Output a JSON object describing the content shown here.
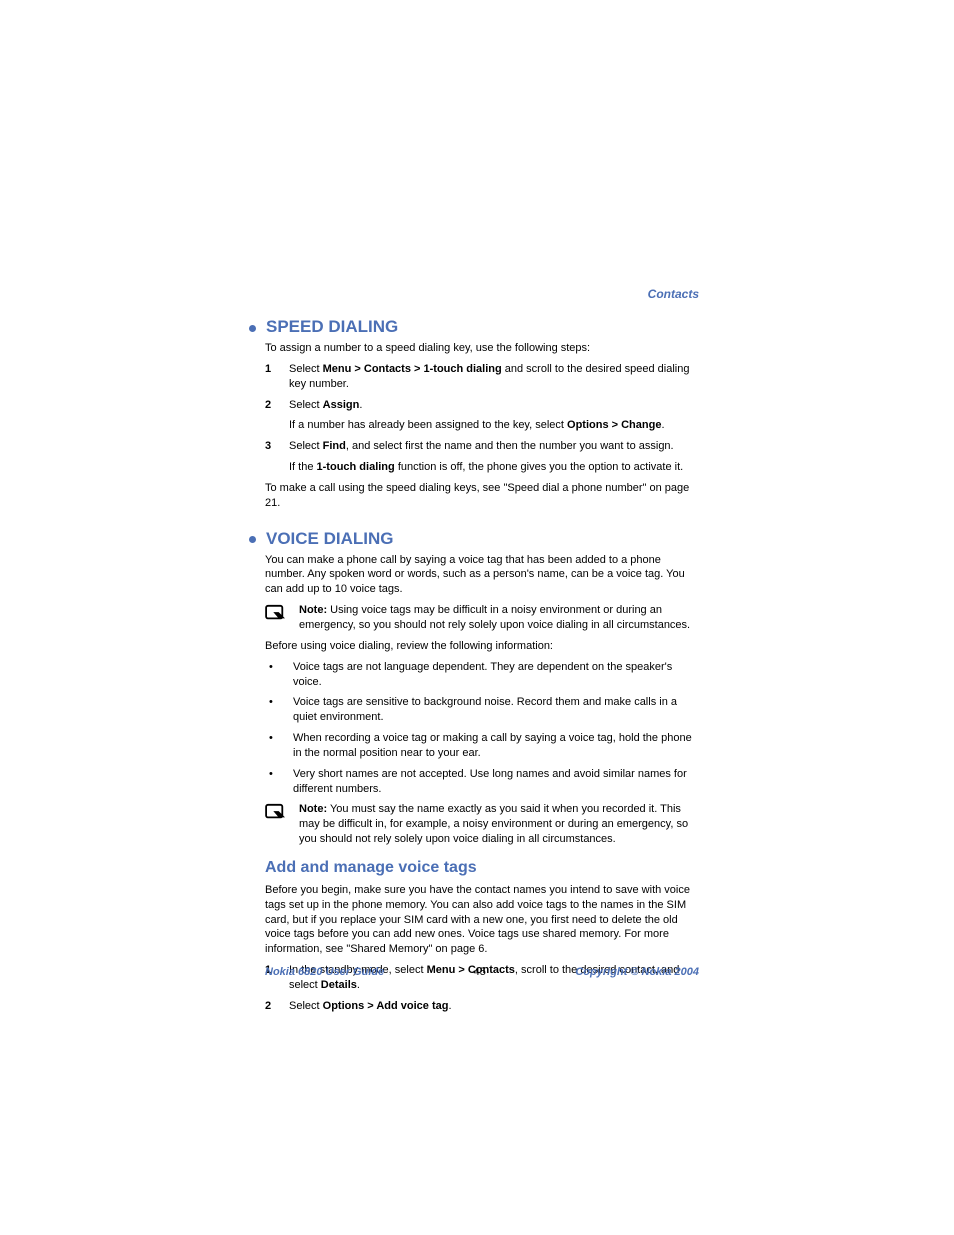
{
  "header": {
    "section": "Contacts"
  },
  "speed": {
    "title": "SPEED DIALING",
    "intro": "To assign a number to a speed dialing key, use the following steps:",
    "steps": [
      {
        "n": "1",
        "a": "Select ",
        "b": "Menu > Contacts > 1-touch dialing",
        "c": " and scroll to the desired speed dialing key number."
      },
      {
        "n": "2",
        "a": "Select ",
        "b": "Assign",
        "c": ".",
        "sub_a": "If a number has already been assigned to the key, select ",
        "sub_b": "Options > Change",
        "sub_c": "."
      },
      {
        "n": "3",
        "a": "Select ",
        "b": "Find",
        "c": ", and select first the name and then the number you want to assign.",
        "sub_a": "If the ",
        "sub_b": "1-touch dialing",
        "sub_c": " function is off, the phone gives you the option to activate it."
      }
    ],
    "outro": "To make a call using the speed dialing keys, see \"Speed dial a phone number\" on page 21."
  },
  "voice": {
    "title": "VOICE DIALING",
    "intro": "You can make a phone call by saying a voice tag that has been added to a phone number. Any spoken word or words, such as a person's name, can be a voice tag. You can add up to 10 voice tags.",
    "note1_label": "Note:",
    "note1_body": " Using voice tags may be difficult in a noisy environment or during an emergency, so you should not rely solely upon voice dialing in all circumstances.",
    "before": "Before using voice dialing, review the following information:",
    "bullets": [
      "Voice tags are not language dependent. They are dependent on the speaker's voice.",
      "Voice tags are sensitive to background noise. Record them and make calls in a quiet environment.",
      "When recording a voice tag or making a call by saying a voice tag, hold the phone in the normal position near to your ear.",
      "Very short names are not accepted. Use long names and avoid similar names for different numbers."
    ],
    "note2_label": "Note:",
    "note2_body": " You must say the name exactly as you said it when you recorded it. This may be difficult in, for example, a noisy environment or during an emergency, so you should not rely solely upon voice dialing in all circumstances."
  },
  "manage": {
    "title": "Add and manage voice tags",
    "intro": "Before you begin, make sure you have the contact names you intend to save with voice tags set up in the phone memory. You can also add voice tags to the names in the SIM card, but if you replace your SIM card with a new one, you first need to delete the old voice tags before you can add new ones. Voice tags use shared memory. For more information, see \"Shared Memory\" on page 6.",
    "steps": [
      {
        "n": "1",
        "a": "In the standby mode, select ",
        "b": "Menu > Contacts",
        "c": ", scroll to the desired contact, and select ",
        "d": "Details",
        "e": "."
      },
      {
        "n": "2",
        "a": "Select ",
        "b": "Options > Add voice tag",
        "c": "."
      }
    ]
  },
  "footer": {
    "left": "Nokia 6820 User Guide",
    "center": "45",
    "right": "Copyright © Nokia 2004"
  }
}
